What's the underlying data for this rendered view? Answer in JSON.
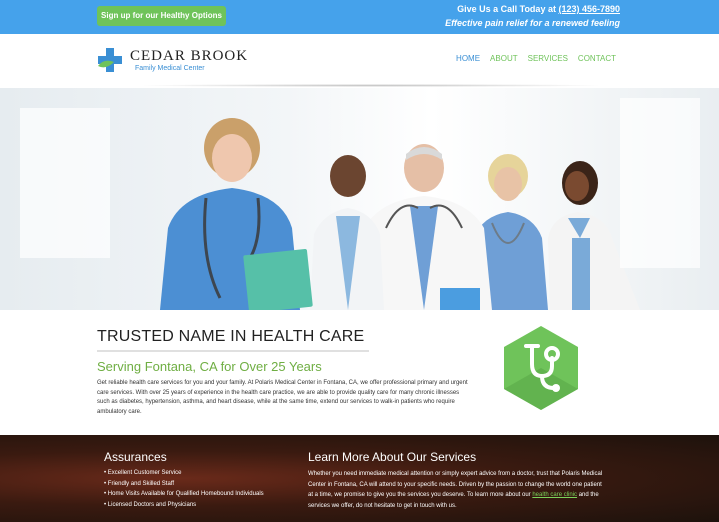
{
  "topbar": {
    "signup_label": "Sign up for our Healthy Options",
    "call_prefix": "Give Us a Call Today at ",
    "phone": "(123) 456-7890",
    "tagline": "Effective pain relief for a renewed feeling"
  },
  "logo": {
    "name": "CEDAR BROOK",
    "subtitle": "Family Medical Center"
  },
  "nav": {
    "items": [
      "HOME",
      "ABOUT",
      "SERVICES",
      "CONTACT"
    ],
    "active": "HOME"
  },
  "intro": {
    "title": "TRUSTED NAME IN HEALTH CARE",
    "subtitle": "Serving Fontana, CA for Over 25 Years",
    "body": "Get reliable health care services for you and your family. At Polaris Medical Center in Fontana, CA, we offer professional primary and urgent care services. With over 25 years of experience in the health care practice, we are able to provide quality care for many chronic illnesses such as diabetes, hypertension, asthma, and heart disease, while at the same time, extend our services to walk-in patients who require ambulatory care.",
    "icon": "stethoscope-icon"
  },
  "assurances": {
    "title": "Assurances",
    "items": [
      "Excellent Customer Service",
      "Friendly and Skilled Staff",
      "Home Visits Available for Qualified Homebound Individuals",
      "Licensed Doctors and Physicians"
    ]
  },
  "learn": {
    "title": "Learn More About Our Services",
    "body_before": "Whether you need immediate medical attention or simply expert advice from a doctor, trust that Polaris Medical Center in Fontana, CA will attend to your specific needs. Driven by the passion to change the world one patient at a time, we promise to give you the services you deserve. To learn more about our ",
    "link": "health care clinic",
    "body_after": " and the services we offer, do not hesitate to get in touch with us."
  },
  "colors": {
    "topbar": "#45a2eb",
    "accent_green": "#6fc35a",
    "nav_blue": "#3a8fd4"
  }
}
